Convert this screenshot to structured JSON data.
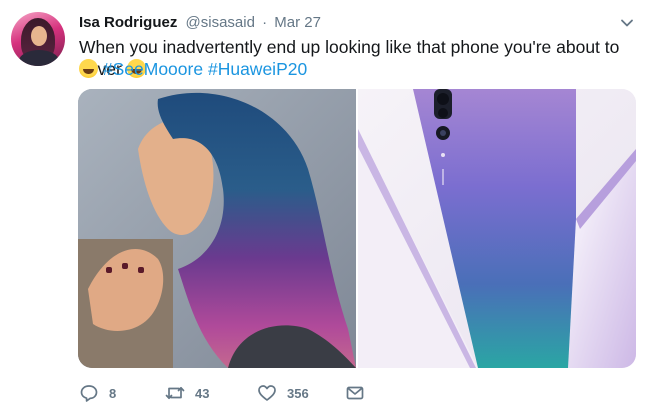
{
  "author": {
    "name": "Isa Rodriguez",
    "handle": "@sisasaid",
    "separator": "·",
    "date": "Mar 27"
  },
  "tweet": {
    "text_main": "When you inadvertently end up looking like that phone you're about to cover",
    "hashtags": [
      "#SeeMooore",
      "#HuaweiP20"
    ],
    "emoji_icons": [
      "face-with-tears-of-joy-emoji",
      "rolling-on-the-floor-laughing-emoji"
    ]
  },
  "media": {
    "images": [
      {
        "icon": "photo-woman-with-blue-purple-hair"
      },
      {
        "icon": "photo-huawei-p20-phone-back"
      }
    ]
  },
  "actions": {
    "reply": {
      "icon": "reply-icon",
      "count": "8"
    },
    "retweet": {
      "icon": "retweet-icon",
      "count": "43"
    },
    "like": {
      "icon": "heart-icon",
      "count": "356"
    },
    "message": {
      "icon": "envelope-icon"
    }
  },
  "colors": {
    "text": "#14171a",
    "secondary": "#657786",
    "link": "#1b95e0"
  }
}
